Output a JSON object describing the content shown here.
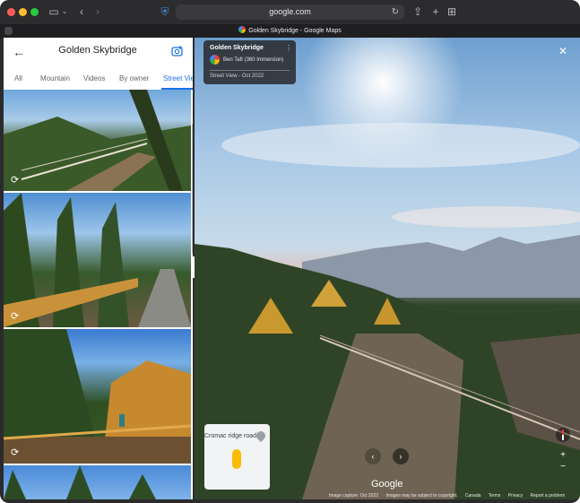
{
  "browser": {
    "address": "google.com",
    "tab_title": "Golden Skybridge - Google Maps"
  },
  "panel": {
    "title": "Golden Skybridge",
    "tabs": [
      {
        "label": "All"
      },
      {
        "label": "Mountain"
      },
      {
        "label": "Videos"
      },
      {
        "label": "By owner"
      },
      {
        "label": "Street View",
        "active": true
      }
    ]
  },
  "info_card": {
    "title": "Golden Skybridge",
    "author": "Ben Taft (360 Immersion)",
    "date": "Street View - Oct 2022"
  },
  "mini_map": {
    "label": "Cromac ridge road"
  },
  "streetview": {
    "logo": "Google",
    "footer": [
      "Image capture: Oct 2022",
      "Images may be subject to copyright.",
      "Canada",
      "Terms",
      "Privacy",
      "Report a problem"
    ]
  }
}
